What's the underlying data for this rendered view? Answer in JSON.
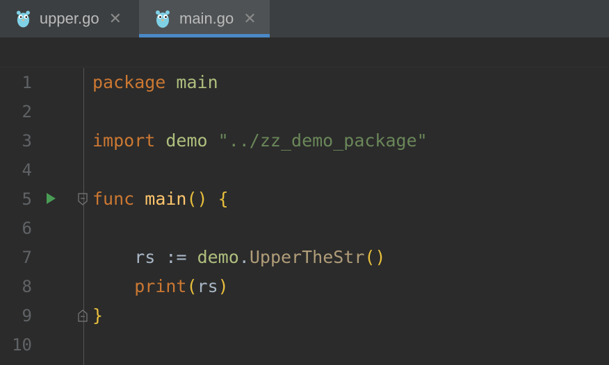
{
  "tabs": [
    {
      "label": "upper.go",
      "close": "✕",
      "active": false
    },
    {
      "label": "main.go",
      "close": "✕",
      "active": true
    }
  ],
  "editor": {
    "lines": [
      {
        "number": "1"
      },
      {
        "number": "2"
      },
      {
        "number": "3"
      },
      {
        "number": "4"
      },
      {
        "number": "5"
      },
      {
        "number": "6"
      },
      {
        "number": "7"
      },
      {
        "number": "8"
      },
      {
        "number": "9"
      },
      {
        "number": "10"
      }
    ],
    "code": {
      "l1_kw": "package",
      "l1_name": "main",
      "l3_kw": "import",
      "l3_alias": "demo",
      "l3_path": "\"../zz_demo_package\"",
      "l5_kw": "func",
      "l5_name": "main",
      "l5_parens": "()",
      "l5_brace": "{",
      "l7_var": "rs",
      "l7_op": ":=",
      "l7_pkg": "demo",
      "l7_dot": ".",
      "l7_call": "UpperTheStr",
      "l7_parens": "()",
      "l8_builtin": "print",
      "l8_open": "(",
      "l8_arg": "rs",
      "l8_close": ")",
      "l9_brace": "}"
    }
  },
  "colors": {
    "keyword": "#cc7832",
    "string": "#6a8759",
    "function": "#ffc66d",
    "accent_underline": "#4a88c7",
    "run_icon": "#499c54"
  },
  "icons": [
    "gopher-icon",
    "close-icon",
    "run-icon",
    "fold-icon"
  ]
}
